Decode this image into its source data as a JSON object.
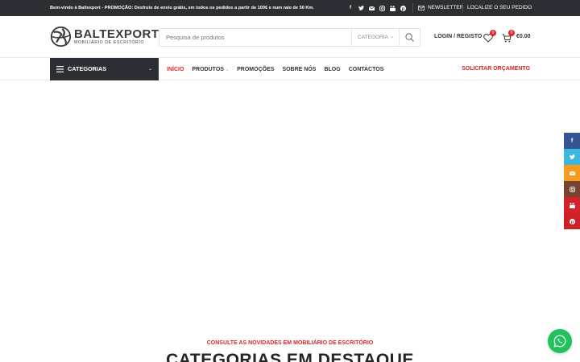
{
  "topbar": {
    "promo": "Bem-vindo à Baltexport - PROMOÇÃO: Desfrute de envio grátis, em todos os pedidos a partir de 100€ e num raio de 50 Km.",
    "socials": [
      "facebook-icon",
      "twitter-icon",
      "email-icon",
      "instagram-icon",
      "youtube-icon",
      "pinterest-icon"
    ],
    "newsletter": "NEWSLETTER",
    "track_order": "LOCALIZE O SEU PEDIDO"
  },
  "header": {
    "brand_name": "BALTEXPORT",
    "brand_sub": "MOBILIÁRIO DE ESCRITÓRIO",
    "search_placeholder": "Pesquisa de produtos",
    "search_category": "CATEGORIA",
    "login": "LOGIN / REGISTO",
    "wishlist_count": "0",
    "cart_count": "0",
    "cart_total": "€0.00"
  },
  "nav": {
    "categories_label": "CATEGORIAS",
    "items": [
      {
        "label": "INÍCIO"
      },
      {
        "label": "PRODUTOS"
      },
      {
        "label": "PROMOÇÕES"
      },
      {
        "label": "SOBRE NÓS"
      },
      {
        "label": "BLOG"
      },
      {
        "label": "CONTACTOS"
      }
    ],
    "quote": "SOLICITAR ORÇAMENTO"
  },
  "side_social": [
    "facebook-icon",
    "twitter-icon",
    "email-icon",
    "instagram-icon",
    "youtube-icon",
    "pinterest-icon"
  ],
  "content": {
    "kicker": "CONSULTE AS NOVIDADES EM MOBILIÁRIO DE ESCRITÓRIO",
    "title": "CATEGORIAS EM DESTAQUE"
  },
  "colors": {
    "accent": "#d9262c",
    "dark": "#2b2f33",
    "whatsapp": "#22c15e"
  }
}
